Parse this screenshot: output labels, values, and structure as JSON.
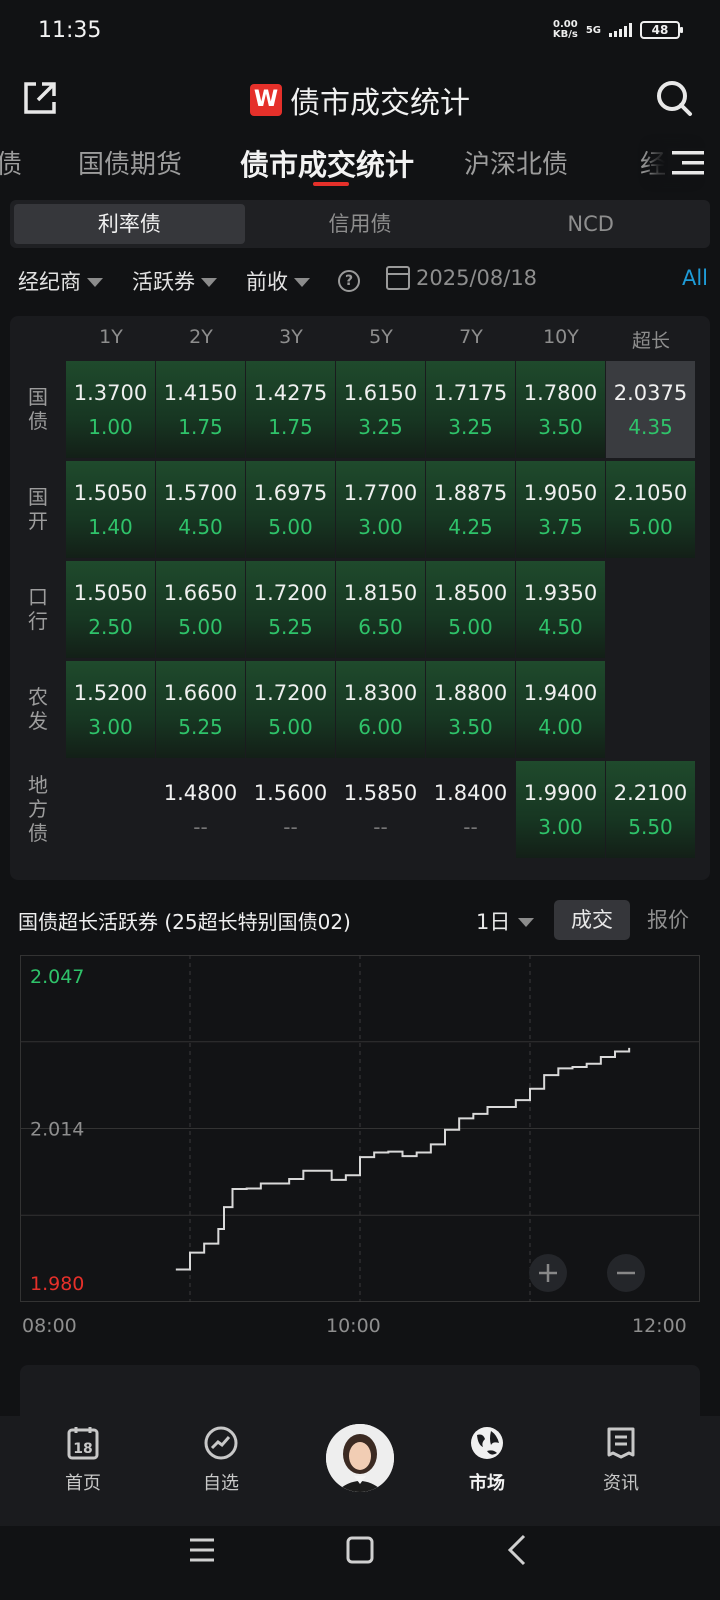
{
  "status": {
    "time": "11:35",
    "net_speed_value": "0.00",
    "net_speed_unit": "KB/s",
    "network": "5G",
    "battery": "48"
  },
  "header": {
    "logo_letter": "W",
    "title": "债市成交统计"
  },
  "tabs": [
    {
      "label": "债"
    },
    {
      "label": "国债期货"
    },
    {
      "label": "债市成交统计",
      "active": true
    },
    {
      "label": "沪深北债"
    },
    {
      "label": "经"
    }
  ],
  "segment": [
    "利率债",
    "信用债",
    "NCD"
  ],
  "filters": {
    "broker": "经纪商",
    "active_bond": "活跃券",
    "prev_close": "前收",
    "help": "?",
    "date": "2025/08/18",
    "all": "All"
  },
  "grid": {
    "columns": [
      "1Y",
      "2Y",
      "3Y",
      "5Y",
      "7Y",
      "10Y",
      "超长"
    ],
    "rows": [
      {
        "label": "国\n债",
        "cells": [
          {
            "y": "1.3700",
            "v": "1.00"
          },
          {
            "y": "1.4150",
            "v": "1.75"
          },
          {
            "y": "1.4275",
            "v": "1.75"
          },
          {
            "y": "1.6150",
            "v": "3.25"
          },
          {
            "y": "1.7175",
            "v": "3.25"
          },
          {
            "y": "1.7800",
            "v": "3.50"
          },
          {
            "y": "2.0375",
            "v": "4.35",
            "selected": true
          }
        ]
      },
      {
        "label": "国\n开",
        "cells": [
          {
            "y": "1.5050",
            "v": "1.40"
          },
          {
            "y": "1.5700",
            "v": "4.50"
          },
          {
            "y": "1.6975",
            "v": "5.00"
          },
          {
            "y": "1.7700",
            "v": "3.00"
          },
          {
            "y": "1.8875",
            "v": "4.25"
          },
          {
            "y": "1.9050",
            "v": "3.75"
          },
          {
            "y": "2.1050",
            "v": "5.00"
          }
        ]
      },
      {
        "label": "口\n行",
        "cells": [
          {
            "y": "1.5050",
            "v": "2.50"
          },
          {
            "y": "1.6650",
            "v": "5.00"
          },
          {
            "y": "1.7200",
            "v": "5.25"
          },
          {
            "y": "1.8150",
            "v": "6.50"
          },
          {
            "y": "1.8500",
            "v": "5.00"
          },
          {
            "y": "1.9350",
            "v": "4.50"
          },
          null
        ]
      },
      {
        "label": "农\n发",
        "cells": [
          {
            "y": "1.5200",
            "v": "3.00"
          },
          {
            "y": "1.6600",
            "v": "5.25"
          },
          {
            "y": "1.7200",
            "v": "5.00"
          },
          {
            "y": "1.8300",
            "v": "6.00"
          },
          {
            "y": "1.8800",
            "v": "3.50"
          },
          {
            "y": "1.9400",
            "v": "4.00"
          },
          null
        ]
      },
      {
        "label": "地\n方\n债",
        "cells": [
          null,
          {
            "y": "1.4800",
            "v": "--"
          },
          {
            "y": "1.5600",
            "v": "--"
          },
          {
            "y": "1.5850",
            "v": "--"
          },
          {
            "y": "1.8400",
            "v": "--"
          },
          {
            "y": "1.9900",
            "v": "3.00"
          },
          {
            "y": "2.2100",
            "v": "5.50"
          }
        ]
      }
    ]
  },
  "chart_section": {
    "title": "国债超长活跃券 (25超长特别国债02)",
    "period": "1日",
    "tabs": [
      "成交",
      "报价"
    ]
  },
  "chart_data": {
    "type": "line",
    "title": "",
    "xlabel": "",
    "ylabel": "",
    "y_tick_labels": [
      "2.047",
      "2.014",
      "1.980"
    ],
    "x_tick_labels": [
      "08:00",
      "10:00",
      "12:00"
    ],
    "ylim": [
      1.98,
      2.047
    ],
    "x_range": [
      "08:00",
      "12:00"
    ],
    "grid": true,
    "series": [
      {
        "color": "#d9d9d9",
        "x": [
          "08:55",
          "09:00",
          "09:05",
          "09:10",
          "09:12",
          "09:15",
          "09:20",
          "09:25",
          "09:30",
          "09:35",
          "09:40",
          "09:45",
          "09:50",
          "09:55",
          "10:00",
          "10:05",
          "10:10",
          "10:15",
          "10:20",
          "10:25",
          "10:30",
          "10:35",
          "10:40",
          "10:45",
          "10:50",
          "10:55",
          "11:00",
          "11:05",
          "11:10",
          "11:15",
          "11:20",
          "11:25",
          "11:30",
          "11:35"
        ],
        "values": [
          1.9823,
          1.986,
          1.988,
          1.9912,
          1.996,
          2.0,
          2.0001,
          2.0012,
          2.0012,
          2.0022,
          2.004,
          2.004,
          2.002,
          2.003,
          2.007,
          2.008,
          2.0082,
          2.0072,
          2.008,
          2.0098,
          2.013,
          2.0155,
          2.0165,
          2.018,
          2.018,
          2.0195,
          2.022,
          2.025,
          2.0265,
          2.0268,
          2.0275,
          2.029,
          2.0302,
          2.031
        ]
      }
    ]
  },
  "bottom_nav": [
    {
      "label": "首页",
      "icon": "calendar-18-icon",
      "badge": "18"
    },
    {
      "label": "自选",
      "icon": "trend-circle-icon"
    },
    {
      "label": "",
      "icon": "avatar"
    },
    {
      "label": "市场",
      "icon": "globe-icon",
      "active": true
    },
    {
      "label": "资讯",
      "icon": "news-icon"
    }
  ]
}
